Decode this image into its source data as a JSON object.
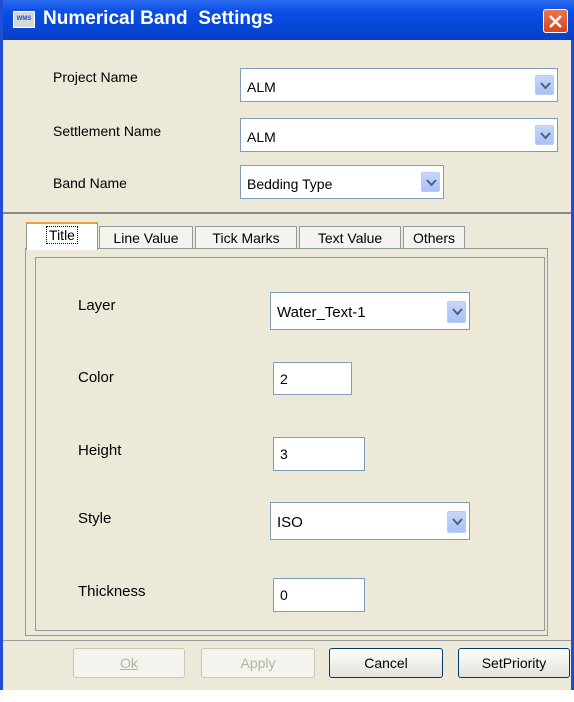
{
  "window": {
    "title": "Numerical Band  Settings",
    "icon_text": "WMS"
  },
  "header": {
    "project_label": "Project Name",
    "project_value": "ALM",
    "settlement_label": "Settlement Name",
    "settlement_value": "ALM",
    "band_label": "Band Name",
    "band_value": "Bedding Type"
  },
  "tabs": [
    {
      "label": "Title",
      "active": true
    },
    {
      "label": "Line Value",
      "active": false
    },
    {
      "label": "Tick Marks",
      "active": false
    },
    {
      "label": "Text Value",
      "active": false
    },
    {
      "label": "Others",
      "active": false
    }
  ],
  "title_tab": {
    "layer_label": "Layer",
    "layer_value": "Water_Text-1",
    "color_label": "Color",
    "color_value": "2",
    "height_label": "Height",
    "height_value": "3",
    "style_label": "Style",
    "style_value": "ISO",
    "thickness_label": "Thickness",
    "thickness_value": "0"
  },
  "buttons": {
    "ok": "Ok",
    "apply": "Apply",
    "cancel": "Cancel",
    "setpriority": "SetPriority"
  },
  "colors": {
    "titlebar": "#0a4ee4",
    "window_bg": "#ece9d8",
    "close_button": "#d4451c",
    "active_tab_accent": "#e8a23a"
  },
  "icons": [
    "app-icon",
    "close-icon",
    "chevron-down-icon"
  ]
}
